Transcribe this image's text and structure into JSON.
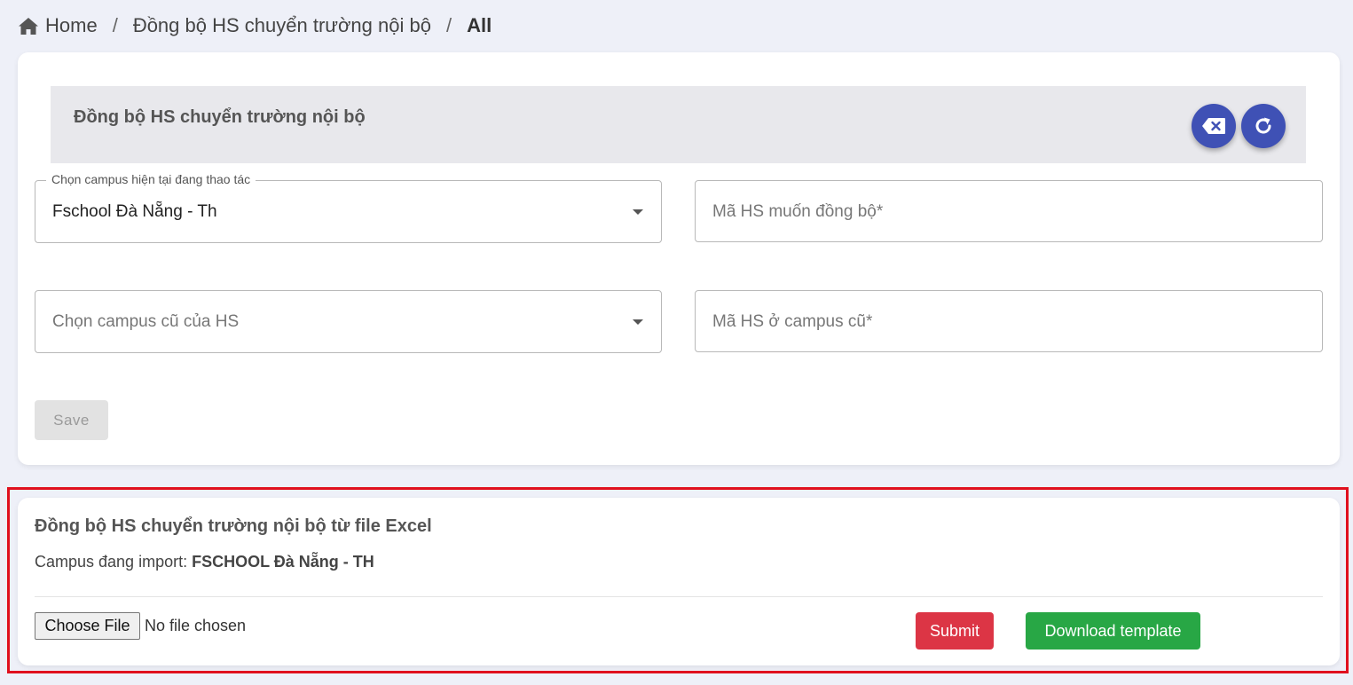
{
  "breadcrumb": {
    "home": "Home",
    "section": "Đồng bộ HS chuyển trường nội bộ",
    "current": "All",
    "separator": "/"
  },
  "form": {
    "title": "Đồng bộ HS chuyển trường nội bộ",
    "current_campus_legend": "Chọn campus hiện tại đang thao tác",
    "current_campus_value": "Fschool Đà Nẵng - Th",
    "student_code_placeholder": "Mã HS muốn đồng bộ*",
    "old_campus_placeholder": "Chọn campus cũ của HS",
    "old_student_code_placeholder": "Mã HS ở campus cũ*",
    "save_label": "Save"
  },
  "import": {
    "title": "Đồng bộ HS chuyển trường nội bộ từ file Excel",
    "campus_label": "Campus đang import: ",
    "campus_value": "FSCHOOL Đà Nẵng - TH",
    "choose_file_label": "Choose File",
    "file_status": "No file chosen",
    "submit_label": "Submit",
    "download_label": "Download template"
  },
  "colors": {
    "primary": "#3f51b5",
    "danger": "#dc3545",
    "success": "#28a745",
    "highlight": "#e0101e",
    "background": "#eef0f8"
  },
  "icons": {
    "home": "home-icon",
    "clear": "backspace-clear-icon",
    "refresh": "refresh-icon",
    "dropdown": "chevron-down-icon"
  }
}
